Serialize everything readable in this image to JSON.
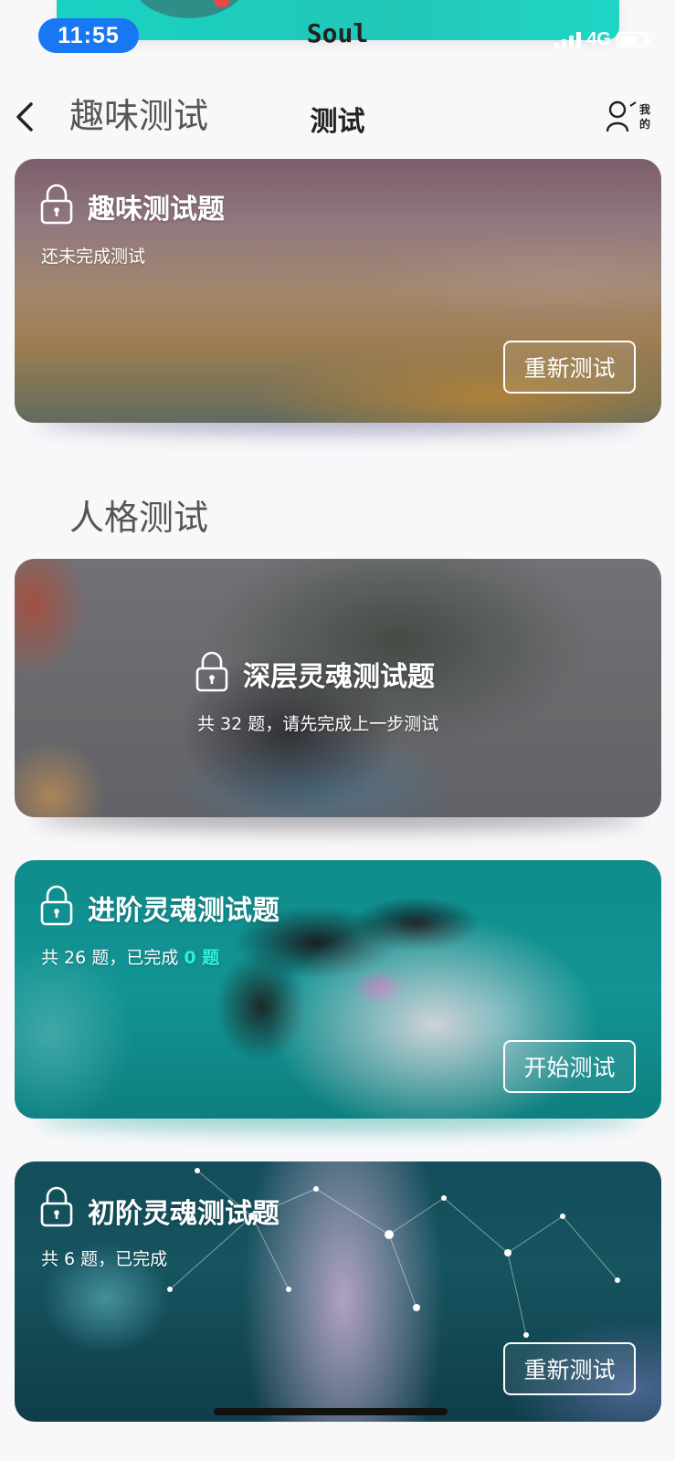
{
  "status_bar": {
    "time": "11:55",
    "carrier_title": "Soul",
    "network": "4G"
  },
  "nav": {
    "back_icon": "chevron-left-icon",
    "section_title": "趣味测试",
    "title": "测试",
    "mine_label": "我的",
    "mine_icon": "user-icon"
  },
  "fun_test_card": {
    "title": "趣味测试题",
    "subtitle": "还未完成测试",
    "button": "重新测试",
    "icon": "lock-icon"
  },
  "personality_section": {
    "heading": "人格测试"
  },
  "cards": [
    {
      "title": "深层灵魂测试题",
      "subtitle": "共 32 题，请先完成上一步测试",
      "icon": "lock-icon",
      "locked": true
    },
    {
      "title": "进阶灵魂测试题",
      "subtitle_prefix": "共 26 题，已完成",
      "completed_count": "0 题",
      "button": "开始测试",
      "icon": "lock-icon",
      "accent": "#2ff0d6"
    },
    {
      "title": "初阶灵魂测试题",
      "subtitle": "共 6 题，已完成",
      "button": "重新测试",
      "icon": "lock-icon"
    }
  ],
  "colors": {
    "time_pill": "#1877f2",
    "banner": "#19d3c2",
    "highlight": "#2ff0d6",
    "page_bg": "#f8f8fa"
  }
}
